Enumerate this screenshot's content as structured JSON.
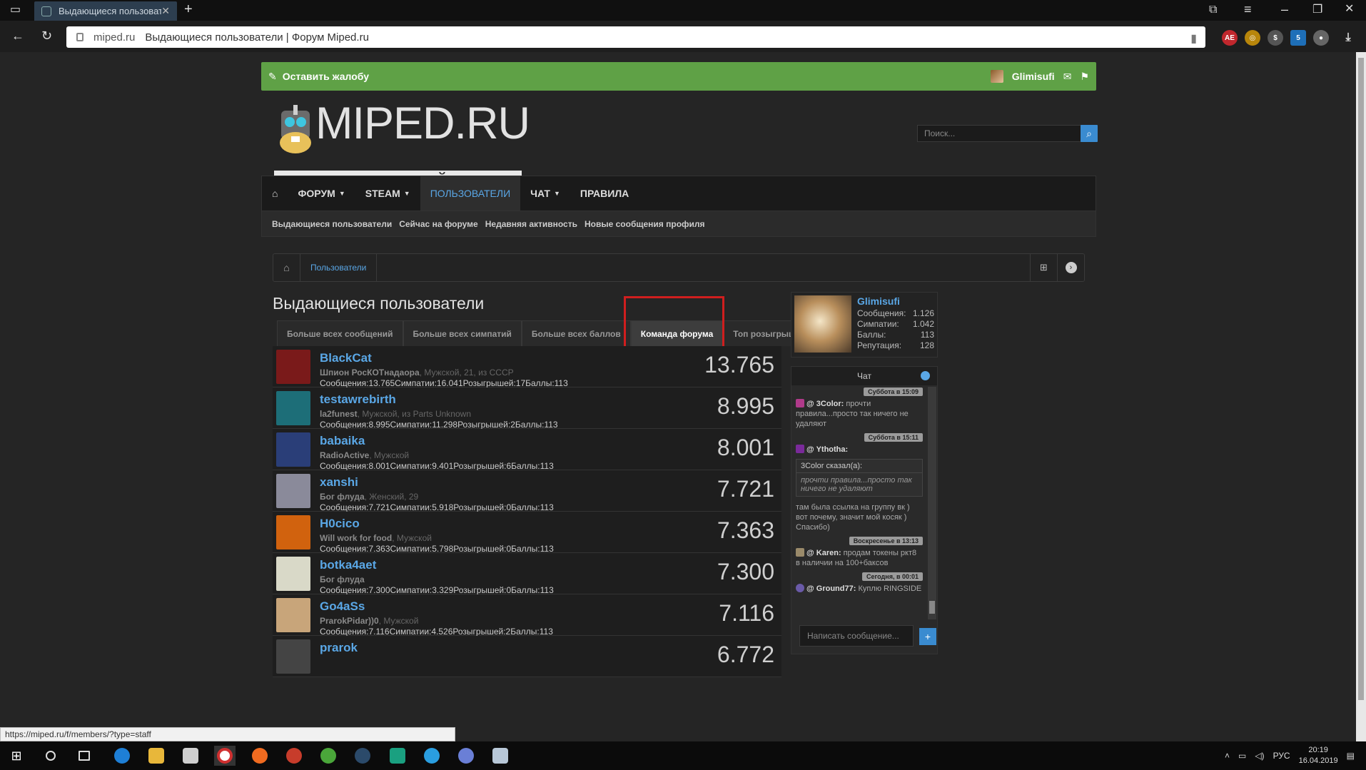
{
  "browser": {
    "tab_title": "Выдающиеся пользоват",
    "url_domain": "miped.ru",
    "url_page_title": "Выдающиеся пользователи | Форум Miped.ru",
    "status_url": "https://miped.ru/f/members/?type=staff"
  },
  "topbar": {
    "complaint_label": "Оставить жалобу",
    "username": "Glimisufi"
  },
  "logo": {
    "title": "MIPED.RU",
    "subtitle": "ИНФОРМАЦИОННЫЙ ПОРТАЛ"
  },
  "search": {
    "placeholder": "Поиск..."
  },
  "nav": {
    "items": [
      {
        "label": "ФОРУМ"
      },
      {
        "label": "STEAM"
      },
      {
        "label": "ПОЛЬЗОВАТЕЛИ"
      },
      {
        "label": "ЧАТ"
      },
      {
        "label": "ПРАВИЛА"
      }
    ],
    "sub": [
      "Выдающиеся пользователи",
      "Сейчас на форуме",
      "Недавняя активность",
      "Новые сообщения профиля"
    ]
  },
  "breadcrumb": {
    "item": "Пользователи"
  },
  "page": {
    "title": "Выдающиеся пользователи"
  },
  "tabs": [
    "Больше всех сообщений",
    "Больше всех симпатий",
    "Больше всех баллов",
    "Команда форума",
    "Топ розыгрышей"
  ],
  "members": [
    {
      "name": "BlackCat",
      "title": "Шпион РосКОТнадаора",
      "meta": ", Мужской, 21, из ",
      "loc": "СССР",
      "stats": "Сообщения:13.765Симпатии:16.041Розыгрышей:17Баллы:113",
      "score": "13.765",
      "color": "#7a1a1a"
    },
    {
      "name": "testawrebirth",
      "title": "la2funest",
      "meta": ", Мужской, из ",
      "loc": "Parts Unknown",
      "stats": "Сообщения:8.995Симпатии:11.298Розыгрышей:2Баллы:113",
      "score": "8.995",
      "color": "#1d6e78"
    },
    {
      "name": "babaika",
      "title": "RadioActive",
      "meta": ", Мужской",
      "loc": "",
      "stats": "Сообщения:8.001Симпатии:9.401Розыгрышей:6Баллы:113",
      "score": "8.001",
      "color": "#2a3e78"
    },
    {
      "name": "xanshi",
      "title": "Бог флуда",
      "meta": ", Женский, 29",
      "loc": "",
      "stats": "Сообщения:7.721Симпатии:5.918Розыгрышей:0Баллы:113",
      "score": "7.721",
      "color": "#8a8a9a"
    },
    {
      "name": "H0cico",
      "title": "Will work for food",
      "meta": ", Мужской",
      "loc": "",
      "stats": "Сообщения:7.363Симпатии:5.798Розыгрышей:0Баллы:113",
      "score": "7.363",
      "color": "#d1620e"
    },
    {
      "name": "botka4aet",
      "title": "Бог флуда",
      "meta": "",
      "loc": "",
      "stats": "Сообщения:7.300Симпатии:3.329Розыгрышей:0Баллы:113",
      "score": "7.300",
      "color": "#d9d9c8"
    },
    {
      "name": "Go4aSs",
      "title": "PrarokPidar))0",
      "meta": ", Мужской",
      "loc": "",
      "stats": "Сообщения:7.116Симпатии:4.526Розыгрышей:2Баллы:113",
      "score": "7.116",
      "color": "#c8a57a"
    },
    {
      "name": "prarok",
      "title": "",
      "meta": "",
      "loc": "",
      "stats": "",
      "score": "6.772",
      "color": "#444"
    }
  ],
  "profile": {
    "name": "Glimisufi",
    "rows": [
      {
        "label": "Сообщения:",
        "value": "1.126"
      },
      {
        "label": "Симпатии:",
        "value": "1.042"
      },
      {
        "label": "Баллы:",
        "value": "113"
      },
      {
        "label": "Репутация:",
        "value": "128"
      }
    ]
  },
  "chat": {
    "title": "Чат",
    "input_placeholder": "Написать сообщение...",
    "send": "+",
    "d1": "Суббота в 15:09",
    "m1_user": "@ 3Color:",
    "m1_text": " прочти правила...просто так ничего не удаляют",
    "d2": "Суббота в 15:11",
    "m2_user": "@ Ythotha:",
    "q_head": "3Color сказал(а):",
    "q_body": "прочти правила...просто так ничего не удаляют",
    "m3_text": "там была ссылка на группу вк ) вот почему, значит мой косяк ) Спасибо)",
    "d3": "Воскресенье в 13:13",
    "m4_user": "@ Karen:",
    "m4_text": " продам токены ркт8 в наличии на 100+баксов",
    "d4": "Сегодня, в 00:01",
    "m5_user": "@ Ground77:",
    "m5_text": " Куплю RINGSIDE"
  },
  "taskbar": {
    "lang": "РУС",
    "time": "20:19",
    "date": "16.04.2019"
  }
}
